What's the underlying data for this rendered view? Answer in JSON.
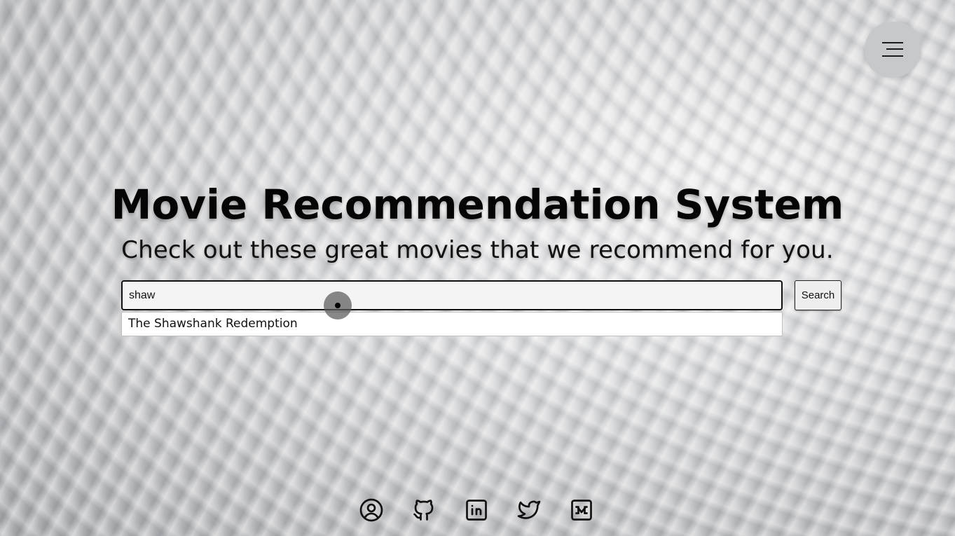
{
  "hero": {
    "title": "Movie Recommendation System",
    "subtitle": "Check out these great movies that we recommend for you."
  },
  "search": {
    "value": "shaw",
    "button_label": "Search"
  },
  "suggestions": [
    "The Shawshank Redemption"
  ],
  "menu": {
    "icon": "hamburger-menu-icon"
  },
  "social_links": [
    {
      "icon": "profile-icon"
    },
    {
      "icon": "github-icon"
    },
    {
      "icon": "linkedin-icon"
    },
    {
      "icon": "twitter-icon"
    },
    {
      "icon": "medium-icon"
    }
  ],
  "colors": {
    "text": "#050505",
    "background": "#c9cacc"
  }
}
